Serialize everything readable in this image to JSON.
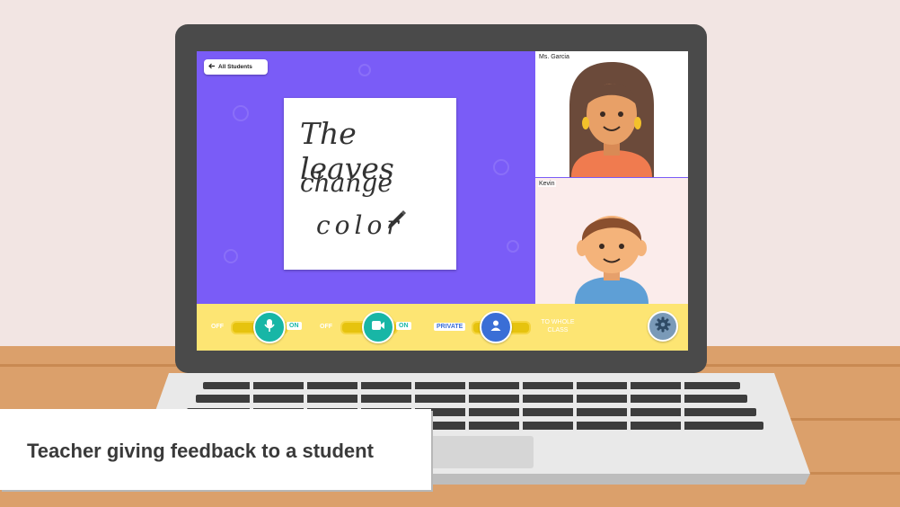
{
  "stage": {
    "back_button": "All Students",
    "whiteboard_lines": [
      "The leaves",
      "change",
      "color"
    ]
  },
  "videos": {
    "teacher_name": "Ms. Garcia",
    "student_name": "Kevin"
  },
  "controls": {
    "mic": {
      "off_label": "OFF",
      "on_label": "ON",
      "state": "on"
    },
    "camera": {
      "off_label": "OFF",
      "on_label": "ON",
      "state": "on"
    },
    "share": {
      "private_label": "PRIVATE",
      "whole_class_label": "TO WHOLE CLASS",
      "state": "private"
    },
    "settings_icon": "gear-icon"
  },
  "caption": "Teacher giving feedback to a student",
  "colors": {
    "screen_purple": "#7a5cf7",
    "control_bar": "#fde573",
    "teal": "#18b6a6",
    "blue": "#3a6ed6"
  }
}
